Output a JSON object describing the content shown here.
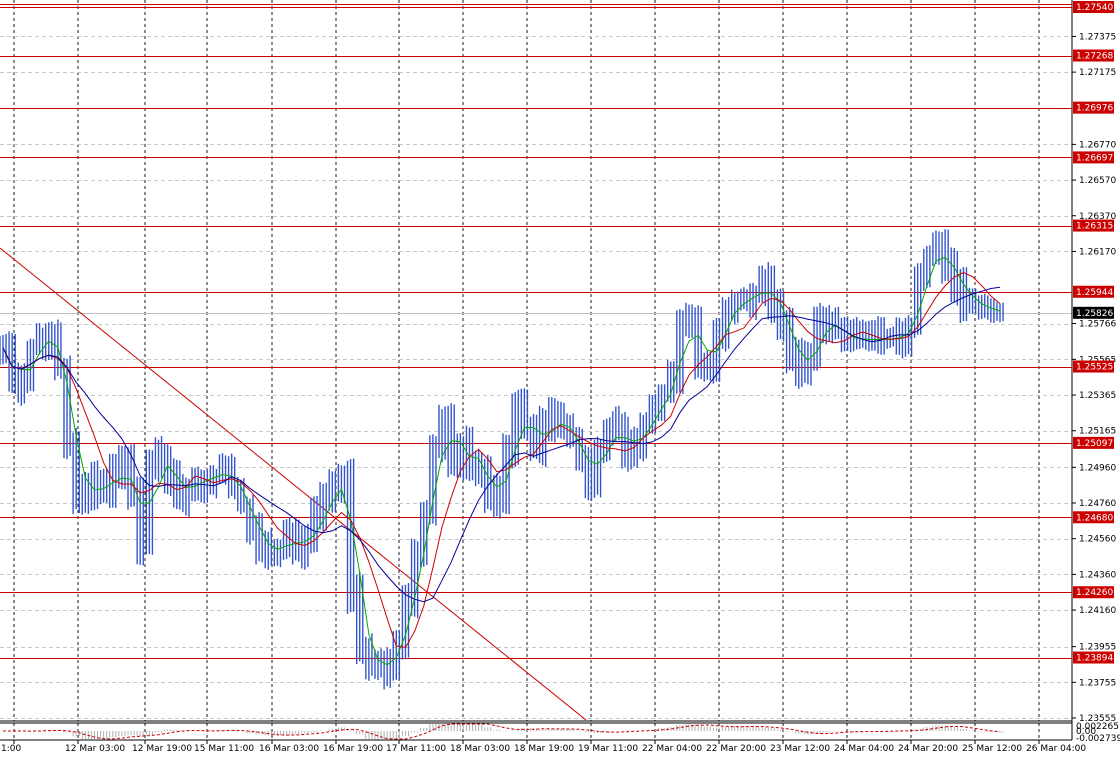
{
  "chart_data": {
    "type": "candlestick",
    "symbol": "",
    "main_price_ticks": [
      "1.27375",
      "1.27175",
      "1.26770",
      "1.26570",
      "1.26370",
      "1.26170",
      "1.25766",
      "1.25565",
      "1.25365",
      "1.25165",
      "1.24960",
      "1.24760",
      "1.24560",
      "1.24360",
      "1.24160",
      "1.23955",
      "1.23755",
      "1.23555"
    ],
    "main_price_tick_values": [
      1.27375,
      1.27175,
      1.2677,
      1.2657,
      1.2637,
      1.2617,
      1.25766,
      1.25565,
      1.25365,
      1.25165,
      1.2496,
      1.2476,
      1.2456,
      1.2436,
      1.2416,
      1.23955,
      1.23755,
      1.23555
    ],
    "levels": [
      {
        "label": "1.27540",
        "value": 1.2754,
        "color": "#cc0000"
      },
      {
        "label": "1.27268",
        "value": 1.27268,
        "color": "#cc0000"
      },
      {
        "label": "1.26976",
        "value": 1.26976,
        "color": "#cc0000"
      },
      {
        "label": "1.26697",
        "value": 1.26697,
        "color": "#cc0000"
      },
      {
        "label": "1.26315",
        "value": 1.26315,
        "color": "#cc0000"
      },
      {
        "label": "1.25944",
        "value": 1.25944,
        "color": "#cc0000"
      },
      {
        "label": "1.25525",
        "value": 1.25525,
        "color": "#cc0000"
      },
      {
        "label": "1.25097",
        "value": 1.25097,
        "color": "#cc0000"
      },
      {
        "label": "1.24680",
        "value": 1.2468,
        "color": "#cc0000"
      },
      {
        "label": "1.24260",
        "value": 1.2426,
        "color": "#cc0000"
      },
      {
        "label": "1.23894",
        "value": 1.23894,
        "color": "#cc0000"
      }
    ],
    "current_price": {
      "label": "1.25826",
      "value": 1.25826,
      "color": "#000000"
    },
    "time_labels": [
      "1:00",
      "12 Mar 03:00",
      "12 Mar 19:00",
      "15 Mar 11:00",
      "16 Mar 03:00",
      "16 Mar 19:00",
      "17 Mar 11:00",
      "18 Mar 03:00",
      "18 Mar 19:00",
      "19 Mar 11:00",
      "22 Mar 04:00",
      "22 Mar 20:00",
      "23 Mar 12:00",
      "24 Mar 04:00",
      "24 Mar 20:00",
      "25 Mar 12:00",
      "26 Mar 04:00"
    ],
    "closes": [
      1.2563,
      1.2542,
      1.2548,
      1.2562,
      1.257,
      1.2568,
      1.2552,
      1.251,
      1.2478,
      1.2482,
      1.249,
      1.248,
      1.2492,
      1.2498,
      1.2478,
      1.2452,
      1.2498,
      1.2505,
      1.2488,
      1.248,
      1.2486,
      1.249,
      1.2488,
      1.2492,
      1.2496,
      1.2485,
      1.2475,
      1.2462,
      1.2452,
      1.2446,
      1.2452,
      1.2458,
      1.245,
      1.2455,
      1.2468,
      1.2475,
      1.2486,
      1.249,
      1.2425,
      1.2396,
      1.2386,
      1.2382,
      1.2388,
      1.2398,
      1.242,
      1.245,
      1.2472,
      1.251,
      1.2525,
      1.2498,
      1.2508,
      1.25,
      1.2495,
      1.2478,
      1.2482,
      1.2505,
      1.253,
      1.252,
      1.2505,
      1.2518,
      1.2525,
      1.2518,
      1.2512,
      1.25,
      1.2488,
      1.2505,
      1.2518,
      1.2515,
      1.2505,
      1.2512,
      1.252,
      1.2528,
      1.2538,
      1.2545,
      1.258,
      1.2575,
      1.2555,
      1.2555,
      1.2572,
      1.2585,
      1.259,
      1.2588,
      1.2595,
      1.2598,
      1.2588,
      1.2578,
      1.256,
      1.2548,
      1.256,
      1.2575,
      1.258,
      1.2572,
      1.2566,
      1.2568,
      1.257,
      1.2565,
      1.2568,
      1.257,
      1.2568,
      1.2575,
      1.2602,
      1.2615,
      1.2618,
      1.2608,
      1.2598,
      1.259,
      1.2588,
      1.2585,
      1.2583,
      1.25826
    ],
    "oscillator_ticks": [
      "0.002265",
      "0.00",
      "-0.002739"
    ],
    "oscillator_tick_values": [
      0.002265,
      0,
      -0.002739
    ]
  }
}
